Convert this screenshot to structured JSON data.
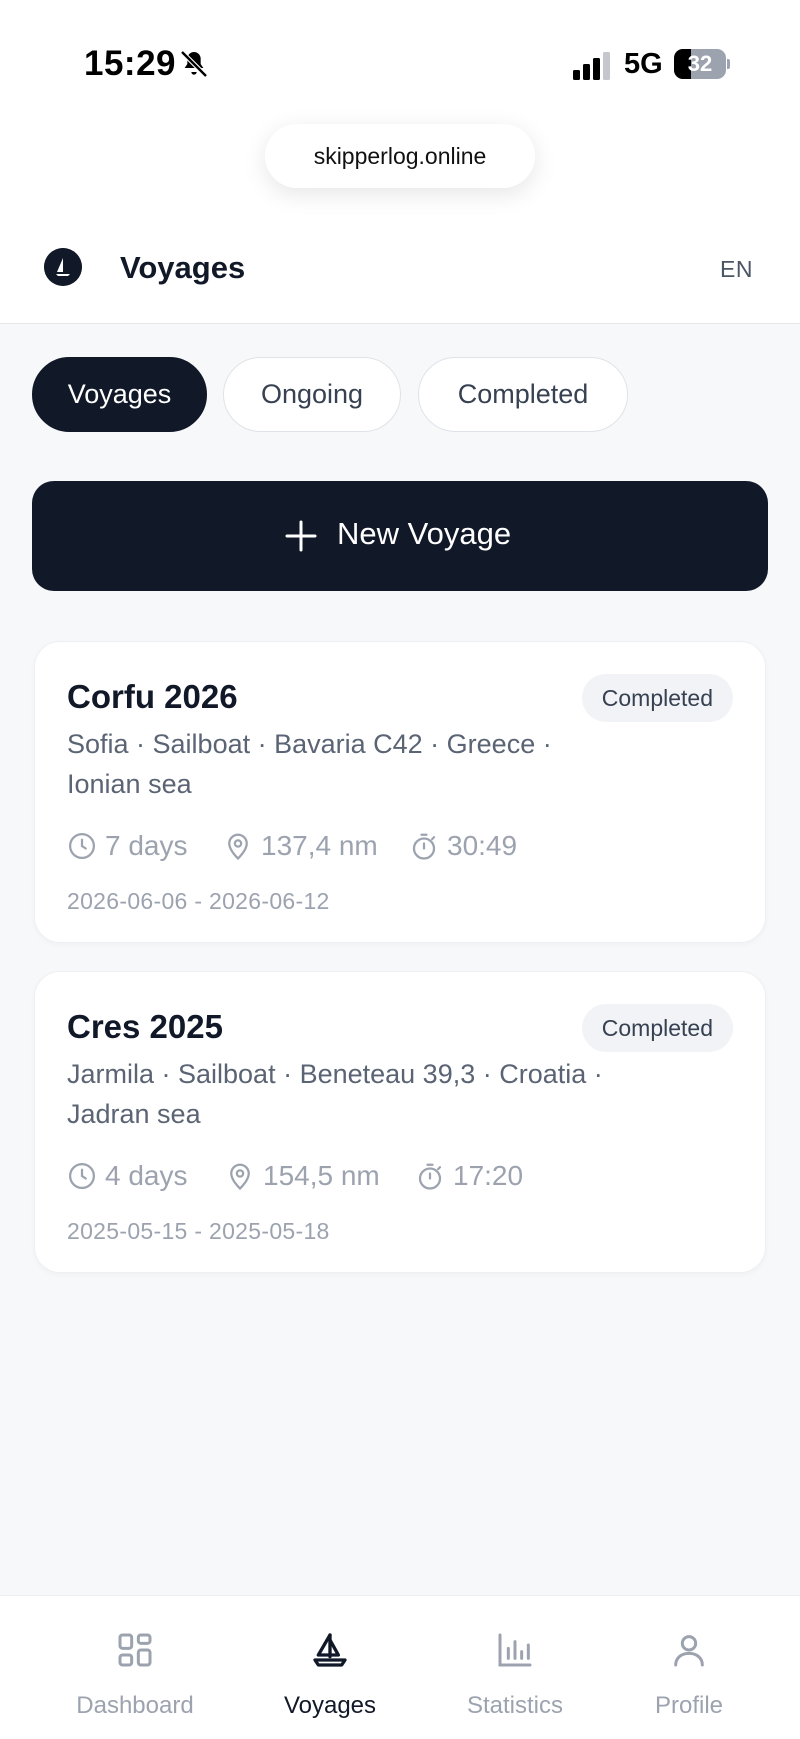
{
  "status_bar": {
    "time": "15:29",
    "network": "5G",
    "battery_percent": "32",
    "battery_level": 0.32
  },
  "browser": {
    "url": "skipperlog.online"
  },
  "header": {
    "title": "Voyages",
    "language": "EN"
  },
  "tabs": [
    {
      "label": "Voyages",
      "active": true
    },
    {
      "label": "Ongoing",
      "active": false
    },
    {
      "label": "Completed",
      "active": false
    }
  ],
  "new_voyage": {
    "label": "New Voyage"
  },
  "voyages": [
    {
      "title": "Corfu 2026",
      "status": "Completed",
      "subtitle": "Sofia · Sailboat · Bavaria C42 · Greece · Ionian sea",
      "days": "7 days",
      "distance": "137,4 nm",
      "duration": "30:49",
      "dates": "2026-06-06 - 2026-06-12"
    },
    {
      "title": "Cres 2025",
      "status": "Completed",
      "subtitle": "Jarmila · Sailboat · Beneteau 39,3 · Croatia · Jadran sea",
      "days": "4 days",
      "distance": "154,5 nm",
      "duration": "17:20",
      "dates": "2025-05-15 - 2025-05-18"
    }
  ],
  "bottom_nav": [
    {
      "label": "Dashboard",
      "icon": "grid-icon",
      "active": false
    },
    {
      "label": "Voyages",
      "icon": "sailboat-icon",
      "active": true
    },
    {
      "label": "Statistics",
      "icon": "bar-chart-icon",
      "active": false
    },
    {
      "label": "Profile",
      "icon": "user-icon",
      "active": false
    }
  ],
  "colors": {
    "primary": "#111827",
    "muted": "#9ca3af",
    "background": "#f7f8fa"
  }
}
